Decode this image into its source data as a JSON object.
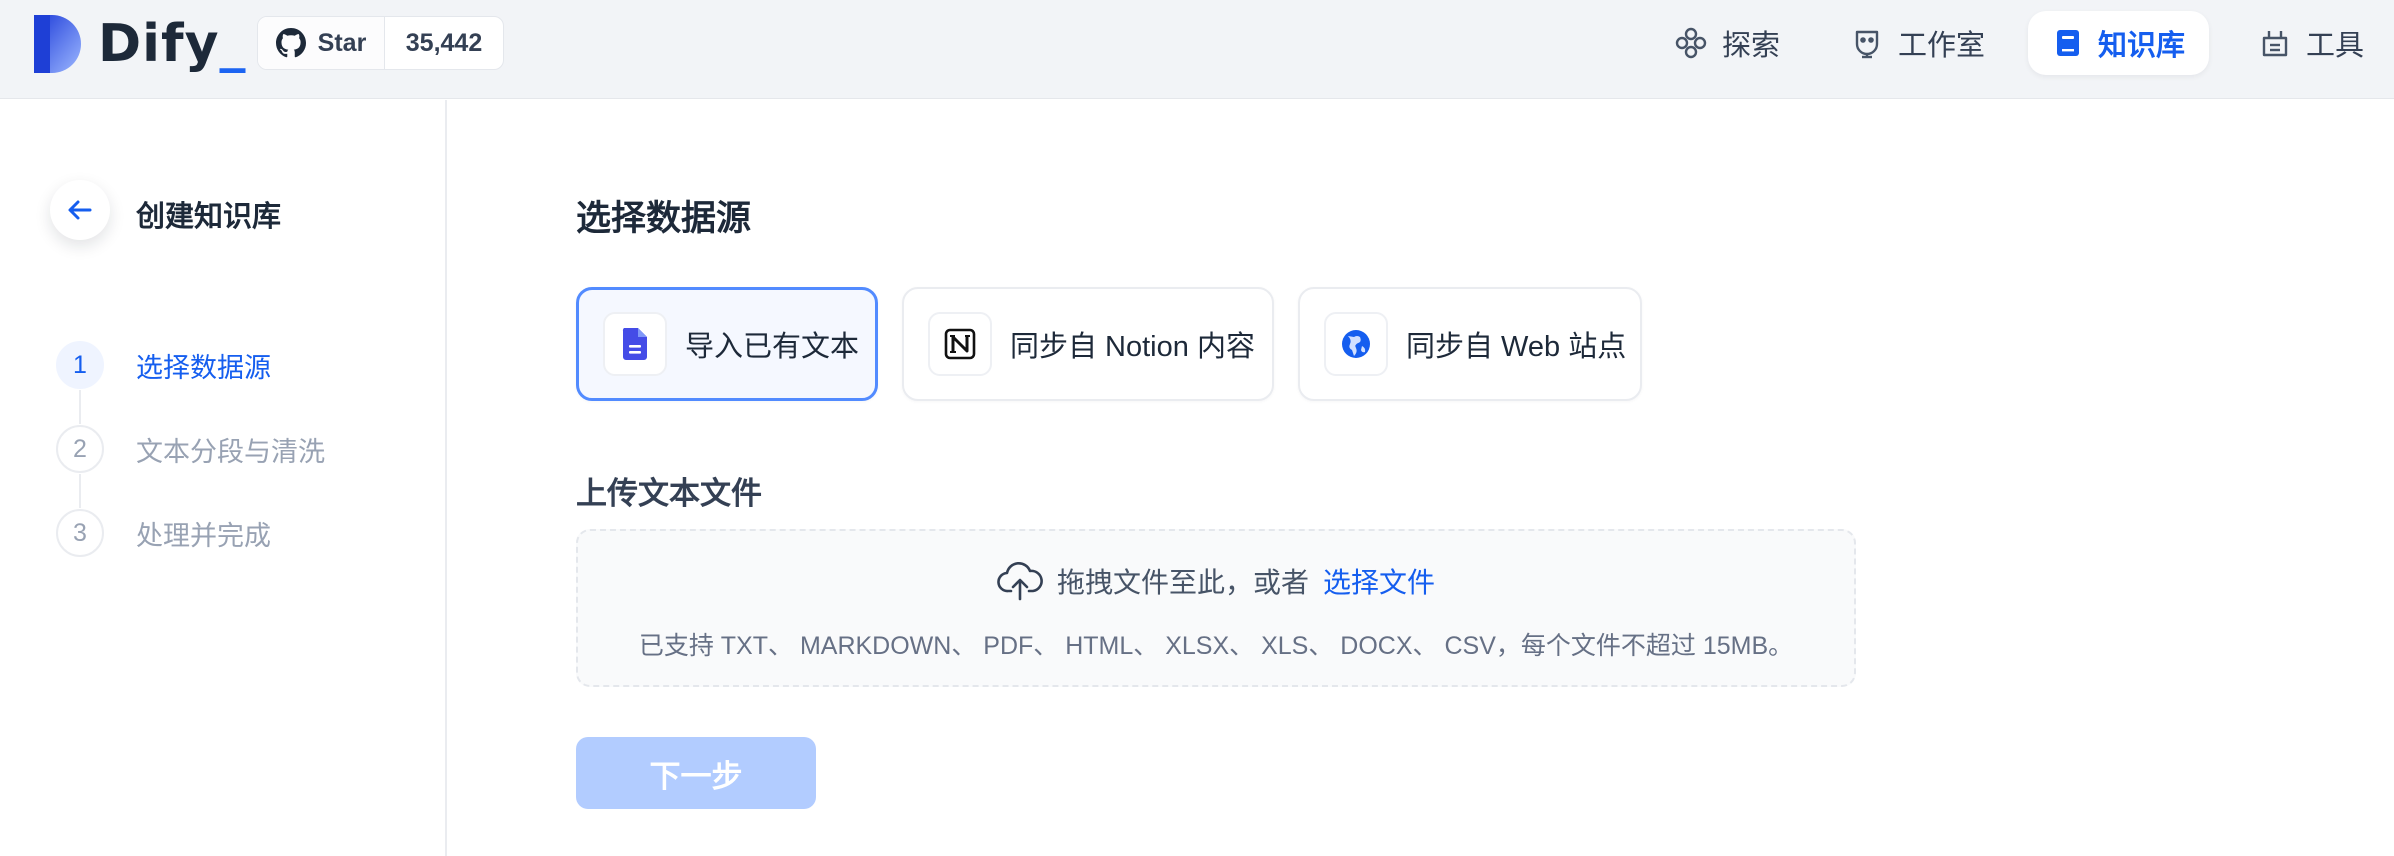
{
  "header": {
    "logo_text": "Dify",
    "logo_suffix": "_",
    "github": {
      "star_label": "Star",
      "star_count": "35,442"
    },
    "nav": [
      {
        "label": "探索",
        "icon": "explore-icon",
        "active": false
      },
      {
        "label": "工作室",
        "icon": "robot-icon",
        "active": false
      },
      {
        "label": "知识库",
        "icon": "book-icon",
        "active": true
      },
      {
        "label": "工具",
        "icon": "tools-icon",
        "active": false
      }
    ]
  },
  "sidebar": {
    "title": "创建知识库",
    "steps": [
      {
        "num": "1",
        "label": "选择数据源",
        "active": true
      },
      {
        "num": "2",
        "label": "文本分段与清洗",
        "active": false
      },
      {
        "num": "3",
        "label": "处理并完成",
        "active": false
      }
    ]
  },
  "main": {
    "title": "选择数据源",
    "sources": [
      {
        "label": "导入已有文本",
        "icon": "file-icon",
        "active": true
      },
      {
        "label": "同步自 Notion 内容",
        "icon": "notion-icon",
        "active": false
      },
      {
        "label": "同步自 Web 站点",
        "icon": "globe-icon",
        "active": false
      }
    ],
    "upload": {
      "title": "上传文本文件",
      "drag_text": "拖拽文件至此，或者",
      "select_link": "选择文件",
      "supported": "已支持 TXT、 MARKDOWN、 PDF、 HTML、 XLSX、 XLS、 DOCX、 CSV，每个文件不超过 15MB。"
    },
    "next_button": "下一步"
  },
  "colors": {
    "accent": "#155eef",
    "header_bg": "#f2f4f7",
    "next_disabled": "#b2ccff"
  }
}
